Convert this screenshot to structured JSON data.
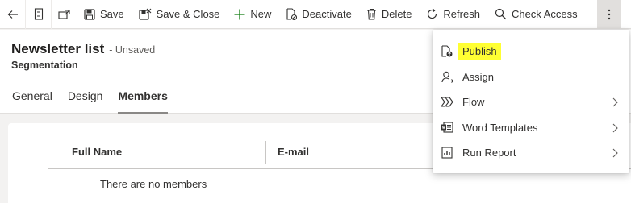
{
  "command_bar": {
    "buttons": [
      {
        "label": "Save",
        "icon": "save-icon"
      },
      {
        "label": "Save & Close",
        "icon": "save-close-icon"
      },
      {
        "label": "New",
        "icon": "plus-icon"
      },
      {
        "label": "Deactivate",
        "icon": "deactivate-icon"
      },
      {
        "label": "Delete",
        "icon": "trash-icon"
      },
      {
        "label": "Refresh",
        "icon": "refresh-icon"
      },
      {
        "label": "Check Access",
        "icon": "check-access-icon"
      }
    ]
  },
  "header": {
    "title": "Newsletter list",
    "status": "- Unsaved",
    "entity": "Segmentation",
    "tabs": [
      {
        "label": "General"
      },
      {
        "label": "Design"
      },
      {
        "label": "Members",
        "active": true
      }
    ]
  },
  "grid": {
    "columns": [
      "Full Name",
      "E-mail"
    ],
    "empty_message": "There are no members"
  },
  "overflow_menu": {
    "items": [
      {
        "label": "Publish",
        "icon": "publish-icon",
        "highlighted": true,
        "has_submenu": false
      },
      {
        "label": "Assign",
        "icon": "assign-icon",
        "has_submenu": false
      },
      {
        "label": "Flow",
        "icon": "flow-icon",
        "has_submenu": true
      },
      {
        "label": "Word Templates",
        "icon": "word-templates-icon",
        "has_submenu": true
      },
      {
        "label": "Run Report",
        "icon": "run-report-icon",
        "has_submenu": true
      }
    ]
  },
  "colors": {
    "highlight": "#ffff33",
    "accent_green": "#107c10",
    "text": "#323130"
  }
}
